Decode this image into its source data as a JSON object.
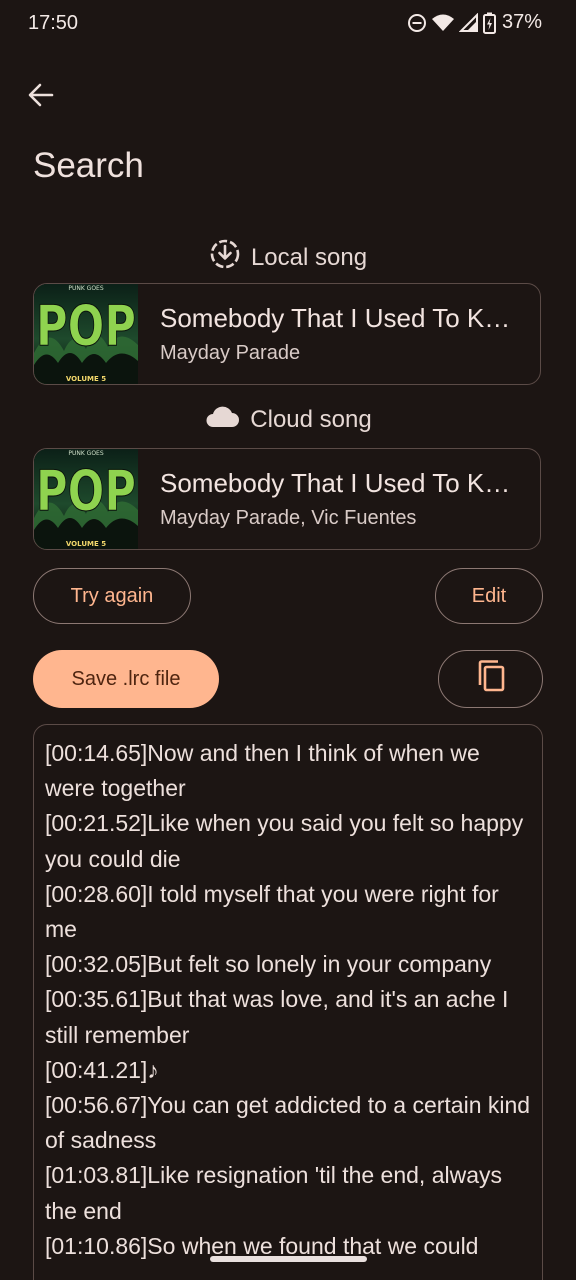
{
  "status_bar": {
    "time": "17:50",
    "battery": "37%",
    "icons": [
      "do-not-disturb-icon",
      "wifi-icon",
      "signal-icon",
      "battery-icon"
    ]
  },
  "header": {
    "back_icon": "arrow-back-icon",
    "title": "Search"
  },
  "local_section": {
    "icon": "download-circle-icon",
    "label": "Local song",
    "song": {
      "title": "Somebody That I Used To Know",
      "artist": "Mayday Parade",
      "cover": {
        "top_text": "PUNK GOES",
        "main_text": "POP",
        "bottom_text": "VOLUME 5"
      }
    }
  },
  "cloud_section": {
    "icon": "cloud-icon",
    "label": "Cloud song",
    "song": {
      "title": "Somebody That I Used To Know",
      "artist": "Mayday Parade, Vic Fuentes",
      "cover": {
        "top_text": "PUNK GOES",
        "main_text": "POP",
        "bottom_text": "VOLUME 5"
      }
    }
  },
  "actions": {
    "try_again": "Try again",
    "edit": "Edit",
    "save": "Save .lrc file",
    "copy_icon": "copy-icon"
  },
  "lyrics": "[00:14.65]Now and then I think of when we were together\n[00:21.52]Like when you said you felt so happy you could die\n[00:28.60]I told myself that you were right for me\n[00:32.05]But felt so lonely in your company\n[00:35.61]But that was love, and it's an ache I still remember\n[00:41.21]♪\n[00:56.67]You can get addicted to a certain kind of sadness\n[01:03.81]Like resignation 'til the end, always the end\n[01:10.86]So when we found that we could",
  "colors": {
    "background": "#1c1513",
    "accent": "#ffb68f",
    "outline": "#8c7873",
    "card_border": "#5b4b47"
  }
}
